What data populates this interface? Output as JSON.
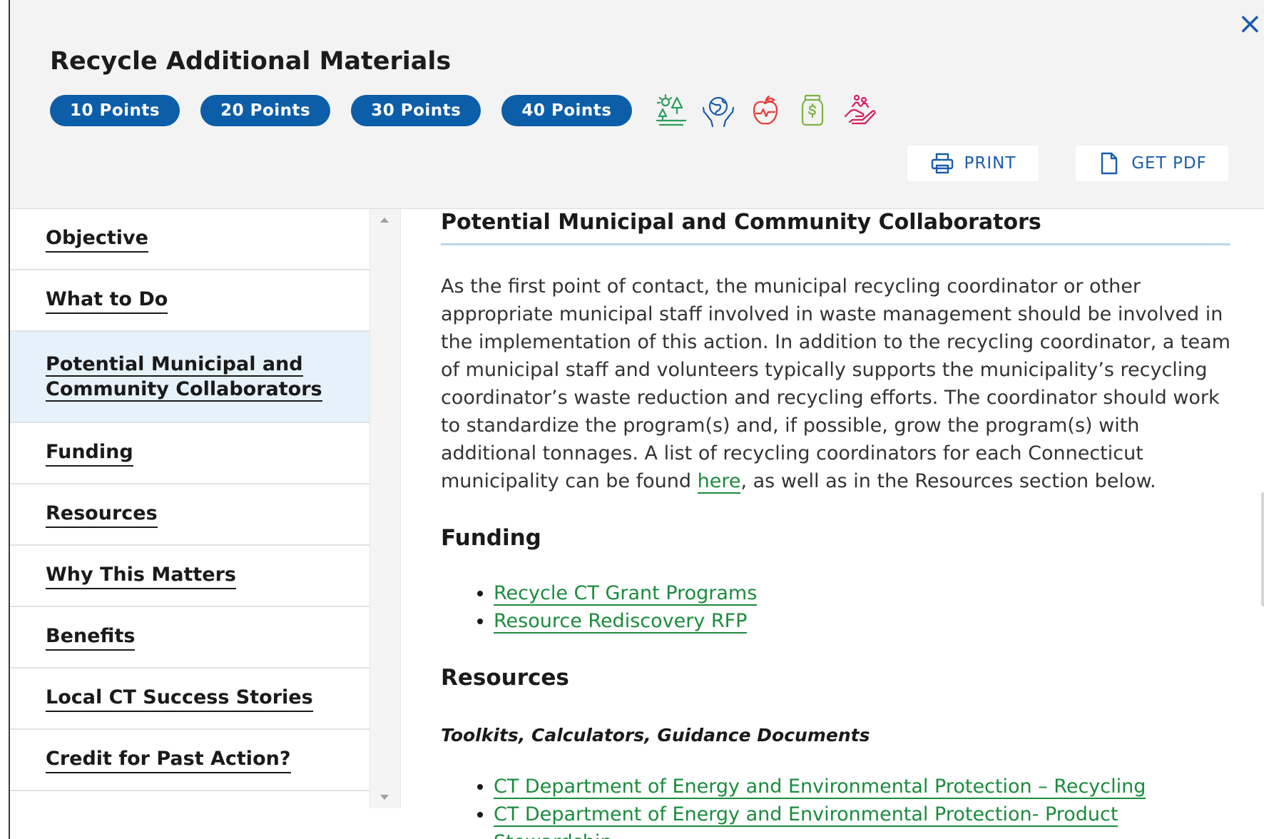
{
  "header": {
    "title": "Recycle Additional Materials",
    "close_label": "×",
    "points": [
      "10 Points",
      "20 Points",
      "30 Points",
      "40 Points"
    ],
    "icons": [
      "sustainability-icon",
      "globe-hands-icon",
      "health-apple-icon",
      "savings-jar-icon",
      "community-hand-icon"
    ],
    "print_label": "PRINT",
    "pdf_label": "GET PDF"
  },
  "sidebar": {
    "items": [
      {
        "label": "Objective"
      },
      {
        "label": "What to Do"
      },
      {
        "label": "Potential Municipal and",
        "label2": "Community Collaborators",
        "active": true
      },
      {
        "label": "Funding"
      },
      {
        "label": "Resources"
      },
      {
        "label": "Why This Matters"
      },
      {
        "label": "Benefits"
      },
      {
        "label": "Local CT Success Stories"
      },
      {
        "label": "Credit for Past Action?"
      }
    ]
  },
  "content": {
    "section1_title": "Potential Municipal and Community Collaborators",
    "para_before_link": "As the first point of contact, the municipal recycling coordinator or other appropriate municipal staff involved in waste management should be involved in the implementation of this action. In addition to the recycling coordinator, a team of municipal staff and volunteers typically supports the municipality’s recycling coordinator’s waste reduction and recycling efforts. The coordinator should work to standardize the program(s) and, if possible, grow the program(s) with additional tonnages. A list of recycling coordinators for each Connecticut municipality can be found ",
    "para_link": "here",
    "para_after_link": ", as well as in the Resources section below.",
    "funding_title": "Funding",
    "funding_links": [
      "Recycle CT Grant Programs",
      "Resource Rediscovery RFP"
    ],
    "resources_title": "Resources",
    "resources_subhead": "Toolkits, Calculators, Guidance Documents",
    "resources_links": [
      "CT Department of Energy and Environmental Protection – Recycling",
      "CT Department of Energy and Environmental Protection- Product Stewardship"
    ]
  },
  "colors": {
    "pill": "#0d5ea8",
    "link": "#1a8c3c",
    "active_bg": "#e6f1f9",
    "icon_green": "#2a9d5c",
    "icon_blue": "#1a5cad",
    "icon_red": "#e53935",
    "icon_lime": "#7cb342",
    "icon_pink": "#d81b60"
  }
}
